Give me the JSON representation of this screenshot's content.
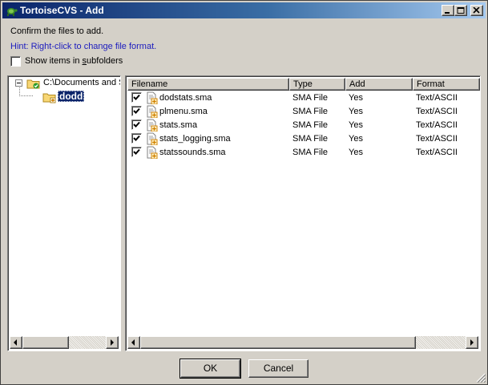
{
  "window": {
    "title": "TortoiseCVS - Add"
  },
  "instructions": "Confirm the files to add.",
  "hint": "Hint: Right-click to change file format.",
  "show_subfolders": {
    "label": "Show items in subfolders",
    "checked": false
  },
  "tree": {
    "root": {
      "label": "C:\\Documents and S",
      "expanded": true
    },
    "child": {
      "label": "dodd",
      "selected": true
    }
  },
  "table": {
    "columns": [
      "Filename",
      "Type",
      "Add",
      "Format"
    ],
    "rows": [
      {
        "checked": true,
        "filename": "dodstats.sma",
        "type": "SMA File",
        "add": "Yes",
        "format": "Text/ASCII"
      },
      {
        "checked": true,
        "filename": "plmenu.sma",
        "type": "SMA File",
        "add": "Yes",
        "format": "Text/ASCII"
      },
      {
        "checked": true,
        "filename": "stats.sma",
        "type": "SMA File",
        "add": "Yes",
        "format": "Text/ASCII"
      },
      {
        "checked": true,
        "filename": "stats_logging.sma",
        "type": "SMA File",
        "add": "Yes",
        "format": "Text/ASCII"
      },
      {
        "checked": true,
        "filename": "statssounds.sma",
        "type": "SMA File",
        "add": "Yes",
        "format": "Text/ASCII"
      }
    ]
  },
  "buttons": {
    "ok": "OK",
    "cancel": "Cancel"
  },
  "colors": {
    "titlebar": "#0a246a",
    "hint": "#1c1cbe",
    "selection": "#0a246a",
    "face": "#d4d0c8"
  }
}
